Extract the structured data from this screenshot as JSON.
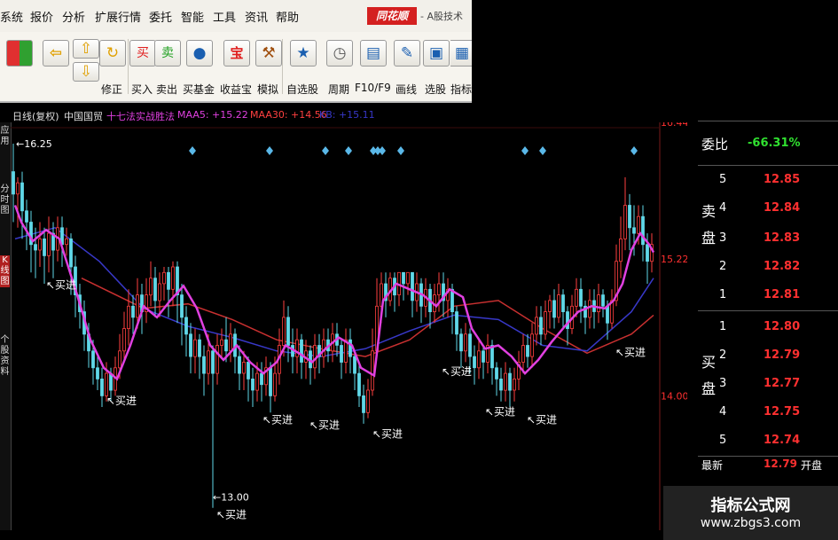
{
  "menubar": {
    "items": [
      "系统",
      "报价",
      "分析",
      "扩展行情",
      "委托",
      "智能",
      "工具",
      "资讯",
      "帮助"
    ],
    "brand_logo": "同花顺",
    "brand_text": "- A股技术"
  },
  "toolbar": {
    "buttons": [
      {
        "label": "",
        "icon": "grid-icon"
      },
      {
        "label": "",
        "icon": "back-arrow-icon"
      },
      {
        "label": "修正",
        "icon": "up-down-arrows-icon"
      },
      {
        "label": "买入",
        "icon": "buy-icon",
        "glyph": "买"
      },
      {
        "label": "卖出",
        "icon": "sell-icon",
        "glyph": "卖"
      },
      {
        "label": "买基金",
        "icon": "fund-icon"
      },
      {
        "label": "收益宝",
        "icon": "treasure-icon",
        "glyph": "宝"
      },
      {
        "label": "模拟",
        "icon": "gavel-icon"
      },
      {
        "label": "自选股",
        "icon": "star-icon"
      },
      {
        "label": "周期",
        "icon": "clock-icon"
      },
      {
        "label": "F10/F9",
        "icon": "info-icon"
      },
      {
        "label": "画线",
        "icon": "pencil-icon"
      },
      {
        "label": "选股",
        "icon": "screen-icon"
      },
      {
        "label": "指标",
        "icon": "indicator-icon"
      }
    ]
  },
  "indicator_bar": {
    "period": "日线(复权)",
    "stock": "中国国贸",
    "strategy": "十七法实战胜法",
    "maa5": "MAA5: +15.22",
    "maa30": "MAA30: +14.56",
    "kb": "KB: +15.11"
  },
  "left_tabs": [
    "应用",
    "分时图",
    "K线图",
    "个股资料"
  ],
  "colors": {
    "up_candle": "#ff4040",
    "down_candle": "#60d8e8",
    "ma5": "#e040e0",
    "ma30": "#3838c8",
    "long_ma": "#c83030",
    "diamond": "#5ab8e8",
    "price_red": "#ff3030",
    "pct_green": "#30e030"
  },
  "chart_data": {
    "type": "candlestick",
    "price_labels": [
      "16.44",
      "15.22",
      "14.00"
    ],
    "annotations": {
      "high": "16.25",
      "low": "13.00",
      "buy_signal": "买进"
    },
    "ma5_path": [
      [
        5,
        15.7
      ],
      [
        12,
        15.55
      ],
      [
        25,
        15.38
      ],
      [
        40,
        15.48
      ],
      [
        55,
        15.4
      ],
      [
        75,
        14.9
      ],
      [
        90,
        14.5
      ],
      [
        105,
        14.25
      ],
      [
        120,
        14.15
      ],
      [
        135,
        14.45
      ],
      [
        150,
        14.8
      ],
      [
        165,
        14.7
      ],
      [
        180,
        14.85
      ],
      [
        195,
        14.98
      ],
      [
        210,
        14.78
      ],
      [
        225,
        14.45
      ],
      [
        240,
        14.32
      ],
      [
        255,
        14.45
      ],
      [
        270,
        14.3
      ],
      [
        285,
        14.2
      ],
      [
        300,
        14.3
      ],
      [
        310,
        14.45
      ],
      [
        325,
        14.38
      ],
      [
        340,
        14.3
      ],
      [
        355,
        14.42
      ],
      [
        370,
        14.52
      ],
      [
        385,
        14.45
      ],
      [
        395,
        14.25
      ],
      [
        410,
        14.18
      ],
      [
        420,
        14.85
      ],
      [
        435,
        15.0
      ],
      [
        450,
        14.95
      ],
      [
        465,
        14.9
      ],
      [
        480,
        14.8
      ],
      [
        495,
        14.95
      ],
      [
        510,
        14.88
      ],
      [
        520,
        14.6
      ],
      [
        535,
        14.42
      ],
      [
        550,
        14.45
      ],
      [
        565,
        14.35
      ],
      [
        580,
        14.2
      ],
      [
        595,
        14.32
      ],
      [
        610,
        14.48
      ],
      [
        625,
        14.62
      ],
      [
        640,
        14.75
      ],
      [
        655,
        14.8
      ],
      [
        670,
        14.78
      ],
      [
        680,
        14.85
      ],
      [
        690,
        15.0
      ],
      [
        700,
        15.3
      ],
      [
        710,
        15.45
      ],
      [
        720,
        15.35
      ],
      [
        725,
        15.28
      ]
    ],
    "ma30_path": [
      [
        5,
        15.4
      ],
      [
        50,
        15.5
      ],
      [
        100,
        15.2
      ],
      [
        150,
        14.78
      ],
      [
        200,
        14.62
      ],
      [
        250,
        14.52
      ],
      [
        300,
        14.4
      ],
      [
        350,
        14.35
      ],
      [
        400,
        14.42
      ],
      [
        450,
        14.58
      ],
      [
        500,
        14.72
      ],
      [
        550,
        14.68
      ],
      [
        600,
        14.45
      ],
      [
        650,
        14.4
      ],
      [
        700,
        14.75
      ],
      [
        725,
        15.05
      ]
    ],
    "long_ma_path": [
      [
        80,
        15.05
      ],
      [
        150,
        14.78
      ],
      [
        200,
        14.82
      ],
      [
        250,
        14.68
      ],
      [
        300,
        14.5
      ],
      [
        350,
        14.42
      ],
      [
        400,
        14.35
      ],
      [
        450,
        14.5
      ],
      [
        500,
        14.8
      ],
      [
        550,
        14.85
      ],
      [
        600,
        14.6
      ],
      [
        650,
        14.38
      ],
      [
        700,
        14.55
      ],
      [
        725,
        14.72
      ]
    ],
    "candles": [
      [
        3,
        16.0,
        15.8,
        16.25,
        15.55
      ],
      [
        8,
        15.8,
        15.9,
        15.95,
        15.5
      ],
      [
        13,
        15.9,
        15.65,
        16.0,
        15.4
      ],
      [
        18,
        15.65,
        15.55,
        15.75,
        15.3
      ],
      [
        23,
        15.55,
        15.35,
        15.65,
        15.1
      ],
      [
        28,
        15.35,
        15.3,
        15.5,
        15.05
      ],
      [
        33,
        15.3,
        15.4,
        15.55,
        15.15
      ],
      [
        38,
        15.4,
        15.25,
        15.5,
        15.0
      ],
      [
        43,
        15.25,
        15.45,
        15.6,
        15.1
      ],
      [
        48,
        15.45,
        15.3,
        15.55,
        15.05
      ],
      [
        53,
        15.3,
        15.5,
        15.6,
        15.2
      ],
      [
        58,
        15.5,
        15.35,
        15.6,
        15.15
      ],
      [
        63,
        15.35,
        15.4,
        15.5,
        15.25
      ],
      [
        68,
        15.4,
        15.15,
        15.45,
        14.9
      ],
      [
        73,
        15.15,
        14.9,
        15.25,
        14.7
      ],
      [
        78,
        14.9,
        14.75,
        15.0,
        14.6
      ],
      [
        83,
        14.75,
        14.55,
        14.85,
        14.4
      ],
      [
        88,
        14.55,
        14.4,
        14.65,
        14.25
      ],
      [
        93,
        14.4,
        14.25,
        14.5,
        14.1
      ],
      [
        98,
        14.25,
        14.15,
        14.35,
        14.05
      ],
      [
        103,
        14.15,
        14.0,
        14.25,
        13.9
      ],
      [
        108,
        14.0,
        14.2,
        14.3,
        13.95
      ],
      [
        113,
        14.2,
        14.05,
        14.25,
        13.95
      ],
      [
        118,
        14.05,
        14.25,
        14.35,
        14.0
      ],
      [
        123,
        14.25,
        14.4,
        14.55,
        14.15
      ],
      [
        128,
        14.4,
        14.6,
        14.75,
        14.3
      ],
      [
        133,
        14.6,
        14.8,
        14.95,
        14.45
      ],
      [
        138,
        14.8,
        14.7,
        14.9,
        14.55
      ],
      [
        143,
        14.7,
        14.9,
        15.05,
        14.6
      ],
      [
        148,
        14.9,
        14.75,
        15.0,
        14.55
      ],
      [
        153,
        14.75,
        14.9,
        15.05,
        14.65
      ],
      [
        158,
        14.9,
        15.05,
        15.2,
        14.8
      ],
      [
        163,
        15.05,
        14.85,
        15.15,
        14.7
      ],
      [
        168,
        14.85,
        15.0,
        15.1,
        14.7
      ],
      [
        173,
        15.0,
        15.1,
        15.15,
        14.85
      ],
      [
        178,
        15.1,
        14.95,
        15.15,
        14.7
      ],
      [
        183,
        14.95,
        15.15,
        15.2,
        14.8
      ],
      [
        188,
        15.15,
        14.9,
        15.2,
        14.65
      ],
      [
        193,
        14.9,
        14.7,
        15.0,
        14.45
      ],
      [
        198,
        14.7,
        14.55,
        14.8,
        14.35
      ],
      [
        203,
        14.55,
        14.35,
        14.65,
        14.2
      ],
      [
        208,
        14.35,
        14.5,
        14.6,
        14.2
      ],
      [
        213,
        14.5,
        14.35,
        14.55,
        14.15
      ],
      [
        218,
        14.35,
        14.2,
        14.45,
        14.0
      ],
      [
        223,
        14.2,
        14.4,
        14.55,
        14.1
      ],
      [
        228,
        14.4,
        14.2,
        14.45,
        13.0
      ],
      [
        233,
        14.2,
        14.45,
        14.55,
        14.1
      ],
      [
        238,
        14.45,
        14.5,
        14.6,
        14.35
      ],
      [
        243,
        14.5,
        14.4,
        14.7,
        14.3
      ],
      [
        248,
        14.4,
        14.55,
        14.65,
        14.3
      ],
      [
        253,
        14.55,
        14.35,
        14.6,
        14.2
      ],
      [
        258,
        14.35,
        14.2,
        14.45,
        14.05
      ],
      [
        263,
        14.2,
        14.3,
        14.4,
        14.05
      ],
      [
        268,
        14.3,
        14.15,
        14.35,
        13.95
      ],
      [
        273,
        14.15,
        14.05,
        14.25,
        13.9
      ],
      [
        278,
        14.05,
        14.2,
        14.3,
        13.95
      ],
      [
        283,
        14.2,
        14.1,
        14.3,
        13.95
      ],
      [
        288,
        14.1,
        14.25,
        14.35,
        14.0
      ],
      [
        293,
        14.25,
        14.0,
        14.3,
        13.85
      ],
      [
        298,
        14.0,
        14.2,
        14.35,
        13.95
      ],
      [
        303,
        14.2,
        14.45,
        14.6,
        14.1
      ],
      [
        308,
        14.45,
        14.7,
        14.85,
        14.35
      ],
      [
        313,
        14.7,
        14.45,
        14.8,
        14.3
      ],
      [
        318,
        14.45,
        14.35,
        14.6,
        14.2
      ],
      [
        323,
        14.35,
        14.5,
        14.6,
        14.2
      ],
      [
        328,
        14.5,
        14.3,
        14.55,
        14.15
      ],
      [
        333,
        14.3,
        14.4,
        14.5,
        14.15
      ],
      [
        338,
        14.4,
        14.25,
        14.45,
        14.1
      ],
      [
        343,
        14.25,
        14.45,
        14.55,
        14.15
      ],
      [
        348,
        14.45,
        14.35,
        14.55,
        14.2
      ],
      [
        353,
        14.35,
        14.5,
        14.6,
        14.25
      ],
      [
        358,
        14.5,
        14.4,
        14.6,
        14.3
      ],
      [
        363,
        14.4,
        14.55,
        14.65,
        14.3
      ],
      [
        368,
        14.55,
        14.45,
        14.65,
        14.35
      ],
      [
        373,
        14.45,
        14.3,
        14.5,
        14.15
      ],
      [
        378,
        14.3,
        14.5,
        14.6,
        14.2
      ],
      [
        383,
        14.5,
        14.35,
        14.6,
        14.2
      ],
      [
        388,
        14.35,
        14.2,
        14.4,
        14.05
      ],
      [
        393,
        14.2,
        14.0,
        14.3,
        13.9
      ],
      [
        398,
        14.0,
        13.85,
        14.1,
        13.75
      ],
      [
        403,
        13.85,
        14.05,
        14.15,
        13.8
      ],
      [
        408,
        14.05,
        14.4,
        14.6,
        14.0
      ],
      [
        413,
        14.4,
        14.8,
        15.05,
        14.35
      ],
      [
        418,
        14.8,
        15.0,
        15.1,
        14.65
      ],
      [
        423,
        15.0,
        14.85,
        15.1,
        14.7
      ],
      [
        428,
        14.85,
        15.05,
        15.1,
        14.8
      ],
      [
        433,
        15.05,
        14.9,
        15.1,
        14.75
      ],
      [
        438,
        14.9,
        15.1,
        15.1,
        14.8
      ],
      [
        443,
        15.1,
        15.0,
        15.1,
        14.85
      ],
      [
        448,
        15.0,
        15.1,
        15.1,
        14.9
      ],
      [
        453,
        15.1,
        14.85,
        15.1,
        14.7
      ],
      [
        458,
        14.85,
        15.0,
        15.1,
        14.75
      ],
      [
        463,
        15.0,
        14.8,
        15.05,
        14.65
      ],
      [
        468,
        14.8,
        14.95,
        15.05,
        14.7
      ],
      [
        473,
        14.95,
        14.75,
        15.0,
        14.6
      ],
      [
        478,
        14.75,
        14.9,
        15.0,
        14.65
      ],
      [
        483,
        14.9,
        15.0,
        15.1,
        14.75
      ],
      [
        488,
        15.0,
        14.85,
        15.1,
        14.7
      ],
      [
        493,
        14.85,
        14.95,
        15.05,
        14.7
      ],
      [
        498,
        14.95,
        14.75,
        15.0,
        14.55
      ],
      [
        503,
        14.75,
        14.55,
        14.8,
        14.4
      ],
      [
        508,
        14.55,
        14.4,
        14.6,
        14.25
      ],
      [
        513,
        14.4,
        14.55,
        14.65,
        14.3
      ],
      [
        518,
        14.55,
        14.35,
        14.6,
        14.2
      ],
      [
        523,
        14.35,
        14.25,
        14.45,
        14.1
      ],
      [
        528,
        14.25,
        14.4,
        14.5,
        14.15
      ],
      [
        533,
        14.4,
        14.3,
        14.45,
        14.15
      ],
      [
        538,
        14.3,
        14.45,
        14.55,
        14.2
      ],
      [
        543,
        14.45,
        14.25,
        14.5,
        14.1
      ],
      [
        548,
        14.25,
        14.15,
        14.3,
        14.0
      ],
      [
        553,
        14.15,
        14.05,
        14.25,
        13.95
      ],
      [
        558,
        14.05,
        14.2,
        14.3,
        13.95
      ],
      [
        563,
        14.2,
        14.05,
        14.25,
        13.9
      ],
      [
        568,
        14.05,
        14.15,
        14.25,
        13.95
      ],
      [
        573,
        14.15,
        14.3,
        14.4,
        14.05
      ],
      [
        578,
        14.3,
        14.45,
        14.55,
        14.2
      ],
      [
        583,
        14.45,
        14.35,
        14.55,
        14.25
      ],
      [
        588,
        14.35,
        14.55,
        14.65,
        14.25
      ],
      [
        593,
        14.55,
        14.7,
        14.8,
        14.45
      ],
      [
        598,
        14.7,
        14.55,
        14.8,
        14.45
      ],
      [
        603,
        14.55,
        14.75,
        14.85,
        14.5
      ],
      [
        608,
        14.75,
        14.85,
        14.9,
        14.6
      ],
      [
        613,
        14.85,
        14.7,
        14.95,
        14.6
      ],
      [
        618,
        14.7,
        14.9,
        15.0,
        14.65
      ],
      [
        623,
        14.9,
        14.75,
        14.95,
        14.6
      ],
      [
        628,
        14.75,
        14.6,
        14.8,
        14.45
      ],
      [
        633,
        14.6,
        14.8,
        14.9,
        14.55
      ],
      [
        638,
        14.8,
        14.95,
        15.05,
        14.7
      ],
      [
        643,
        14.95,
        14.8,
        15.05,
        14.65
      ],
      [
        648,
        14.8,
        14.7,
        14.85,
        14.55
      ],
      [
        653,
        14.7,
        14.85,
        14.95,
        14.6
      ],
      [
        658,
        14.85,
        14.75,
        14.95,
        14.6
      ],
      [
        663,
        14.75,
        14.9,
        15.0,
        14.65
      ],
      [
        668,
        14.9,
        14.8,
        14.95,
        14.7
      ],
      [
        673,
        14.8,
        14.65,
        14.85,
        14.5
      ],
      [
        678,
        14.65,
        14.85,
        14.95,
        14.6
      ],
      [
        683,
        14.85,
        15.2,
        15.35,
        14.8
      ],
      [
        688,
        15.2,
        15.4,
        15.6,
        15.05
      ],
      [
        693,
        15.4,
        15.7,
        15.95,
        15.3
      ],
      [
        698,
        15.7,
        15.5,
        15.8,
        15.3
      ],
      [
        703,
        15.5,
        15.45,
        15.7,
        15.25
      ],
      [
        708,
        15.45,
        15.6,
        15.7,
        15.35
      ],
      [
        713,
        15.6,
        15.35,
        15.7,
        15.2
      ],
      [
        718,
        15.35,
        15.2,
        15.45,
        15.0
      ],
      [
        723,
        15.2,
        15.35,
        15.45,
        15.1
      ]
    ],
    "buy_signals": [
      [
        40,
        15.05
      ],
      [
        108,
        14.02
      ],
      [
        232,
        13.0
      ],
      [
        284,
        13.85
      ],
      [
        337,
        13.8
      ],
      [
        408,
        13.72
      ],
      [
        486,
        14.28
      ],
      [
        535,
        13.92
      ],
      [
        582,
        13.85
      ],
      [
        682,
        14.45
      ]
    ],
    "diamonds": [
      205,
      292,
      355,
      381,
      409,
      414,
      419,
      440,
      580,
      600,
      703
    ],
    "ylim": [
      12.8,
      16.44
    ]
  },
  "order_book": {
    "weibi_label": "委比",
    "weibi_value": "-66.31%",
    "sell_label": "卖盘",
    "buy_label": "买盘",
    "sells": [
      {
        "level": "5",
        "price": "12.85"
      },
      {
        "level": "4",
        "price": "12.84"
      },
      {
        "level": "3",
        "price": "12.83"
      },
      {
        "level": "2",
        "price": "12.82"
      },
      {
        "level": "1",
        "price": "12.81"
      }
    ],
    "buys": [
      {
        "level": "1",
        "price": "12.80"
      },
      {
        "level": "2",
        "price": "12.79"
      },
      {
        "level": "3",
        "price": "12.77"
      },
      {
        "level": "4",
        "price": "12.75"
      },
      {
        "level": "5",
        "price": "12.74"
      }
    ],
    "latest_label": "最新",
    "latest_price": "12.79",
    "latest_extra": "开盘"
  },
  "watermark": {
    "title": "指标公式网",
    "url": "www.zbgs3.com"
  }
}
